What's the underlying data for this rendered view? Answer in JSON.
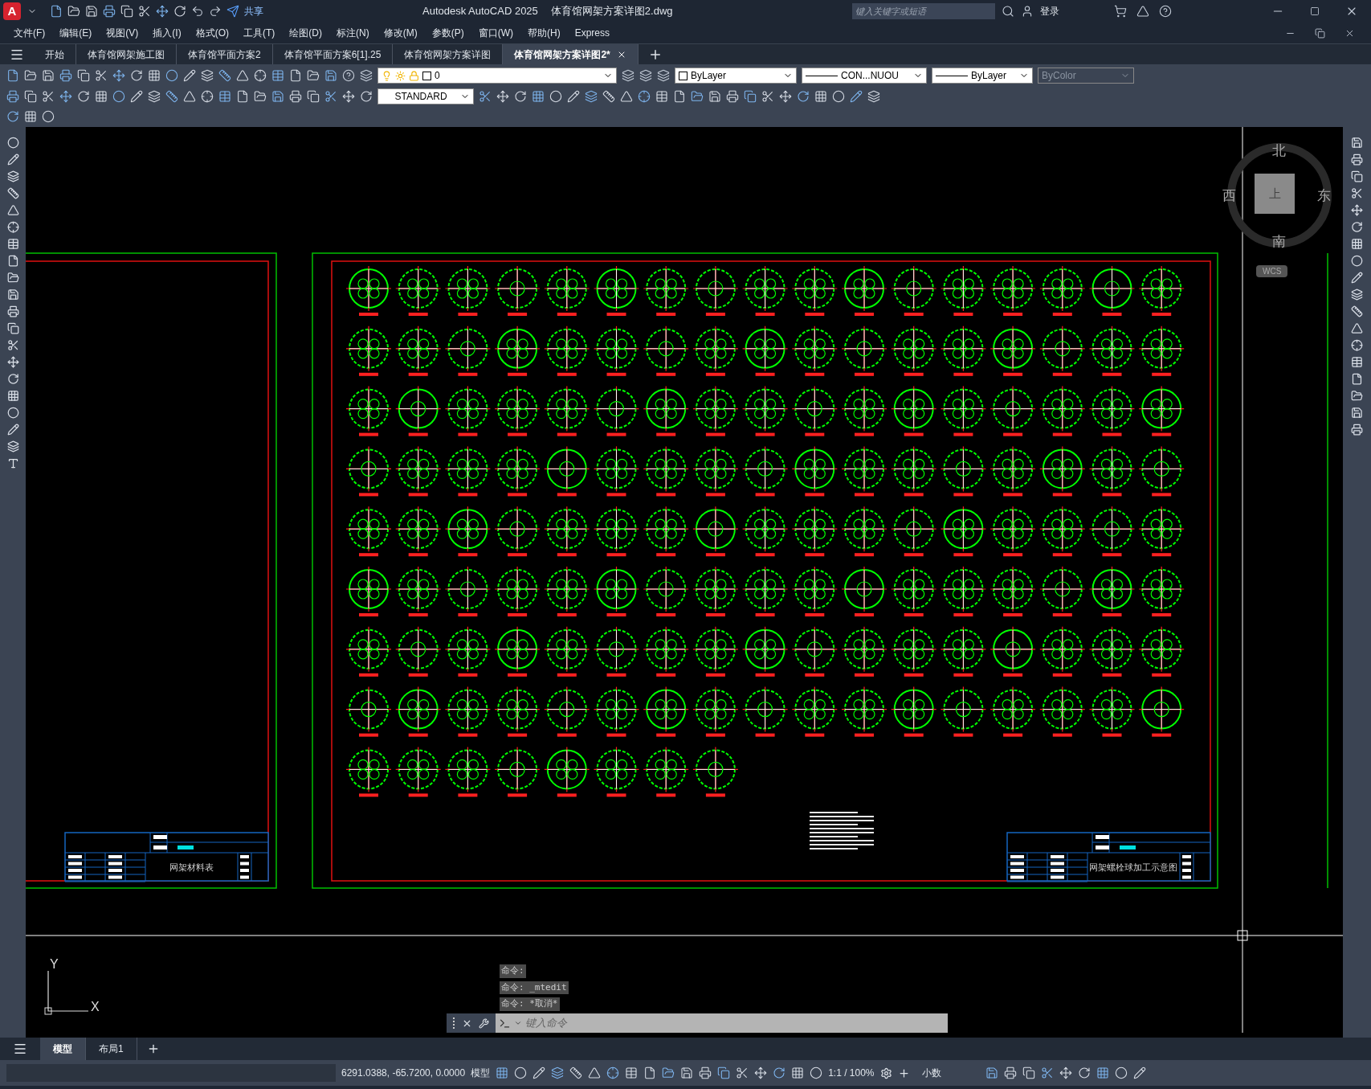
{
  "title_bar": {
    "logo": "A",
    "share": "共享",
    "app_title": "Autodesk AutoCAD 2025",
    "file_name": "体育馆网架方案详图2.dwg",
    "search_placeholder": "键入关键字或短语",
    "login": "登录"
  },
  "menu": [
    "文件(F)",
    "编辑(E)",
    "视图(V)",
    "插入(I)",
    "格式(O)",
    "工具(T)",
    "绘图(D)",
    "标注(N)",
    "修改(M)",
    "参数(P)",
    "窗口(W)",
    "帮助(H)",
    "Express"
  ],
  "file_tabs": [
    {
      "label": "开始",
      "selected": false
    },
    {
      "label": "体育馆网架施工图",
      "selected": false
    },
    {
      "label": "体育馆平面方案2",
      "selected": false
    },
    {
      "label": "体育馆平面方案6[1].25",
      "selected": false
    },
    {
      "label": "体育馆网架方案详图",
      "selected": false
    },
    {
      "label": "体育馆网架方案详图2*",
      "selected": true
    }
  ],
  "toolbar": {
    "layer": "0",
    "color_control": "ByLayer",
    "linetype": "CON...NUOU",
    "lineweight": "ByLayer",
    "plot_style": {
      "label": "ByColor",
      "disabled": true
    },
    "text_style": "STANDARD"
  },
  "viewcube": {
    "north": "北",
    "south": "南",
    "east": "东",
    "west": "西",
    "top": "上",
    "wcs": "WCS"
  },
  "drawing": {
    "sheets": [
      {
        "title": "网架材料表"
      },
      {
        "title": "网架螺栓球加工示意图"
      }
    ]
  },
  "ucs": {
    "x": "X",
    "y": "Y"
  },
  "command_history": [
    "命令:",
    "命令: _mtedit",
    "命令: *取消*"
  ],
  "command_placeholder": "键入命令",
  "layout_tabs": [
    {
      "label": "模型",
      "selected": true
    },
    {
      "label": "布局1",
      "selected": false
    }
  ],
  "status_bar": {
    "coordinates": "6291.0388, -65.7200, 0.0000",
    "space": "模型",
    "scale": "1:1 / 100%",
    "units": "小数"
  }
}
